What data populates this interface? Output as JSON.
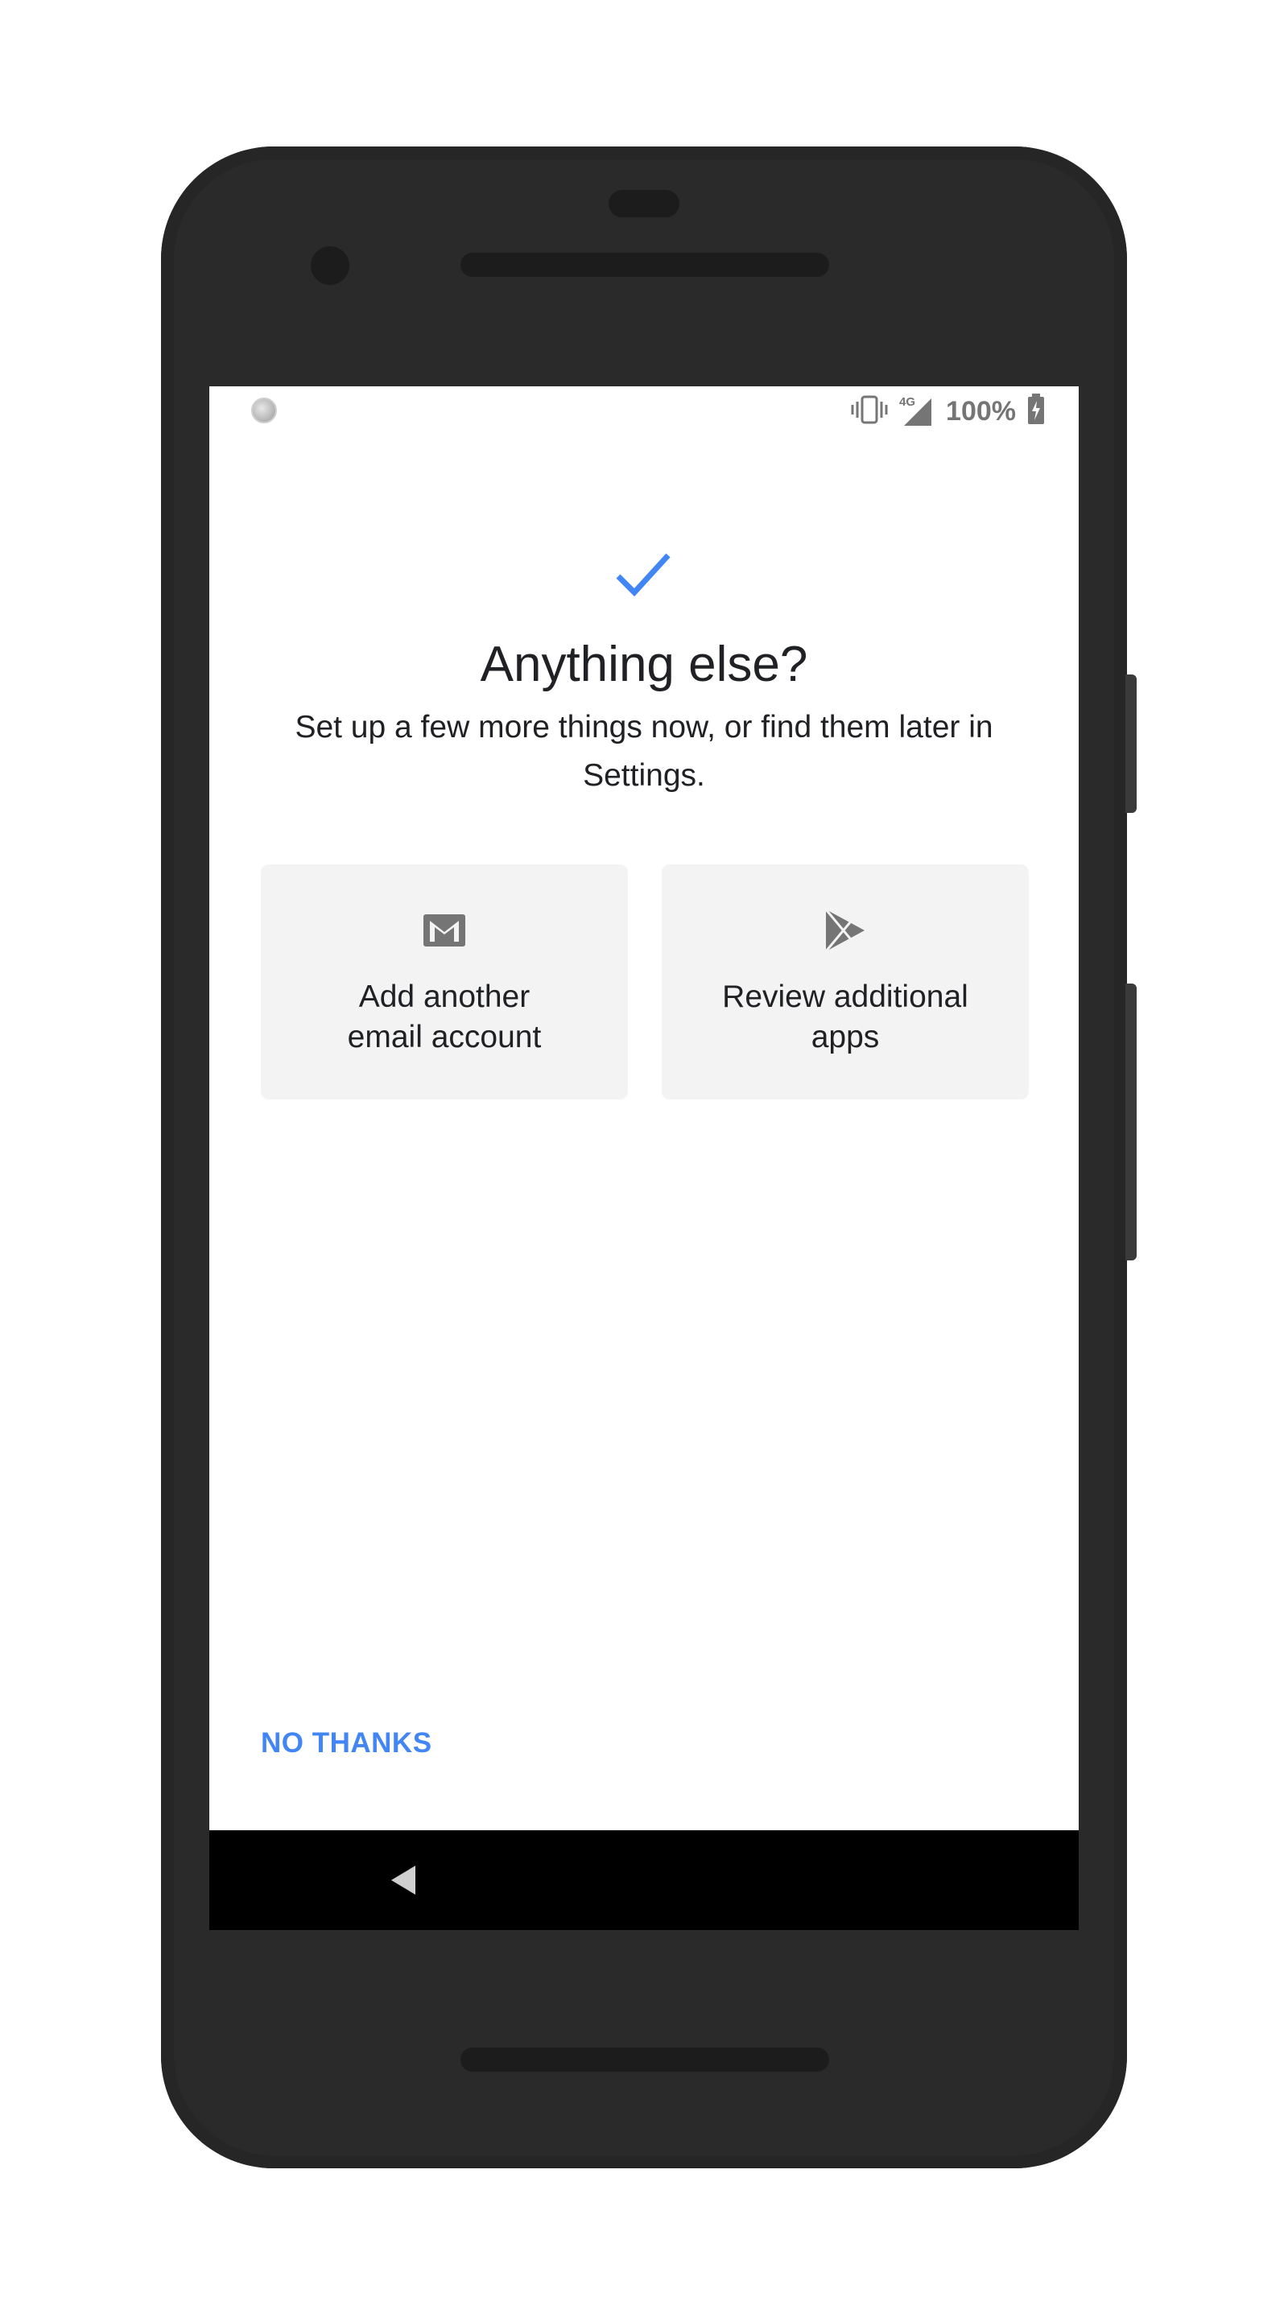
{
  "status_bar": {
    "network_label": "4G",
    "battery_text": "100%",
    "icons": [
      "notification-dot-icon",
      "vibrate-icon",
      "signal-icon",
      "battery-charging-icon"
    ]
  },
  "main": {
    "check_icon": "check-icon",
    "title": "Anything else?",
    "subtitle": "Set up a few more things now, or find them later in Settings.",
    "cards": [
      {
        "icon": "gmail-icon",
        "label": "Add another\nemail account"
      },
      {
        "icon": "play-store-icon",
        "label": "Review additional\napps"
      }
    ],
    "skip_label": "NO THANKS"
  },
  "nav_bar": {
    "back_icon": "back-triangle-icon"
  },
  "colors": {
    "accent": "#4285f4",
    "card_bg": "#f3f3f3",
    "text": "#202124",
    "device_body": "#2a2a2a",
    "nav_bar": "#000000"
  }
}
